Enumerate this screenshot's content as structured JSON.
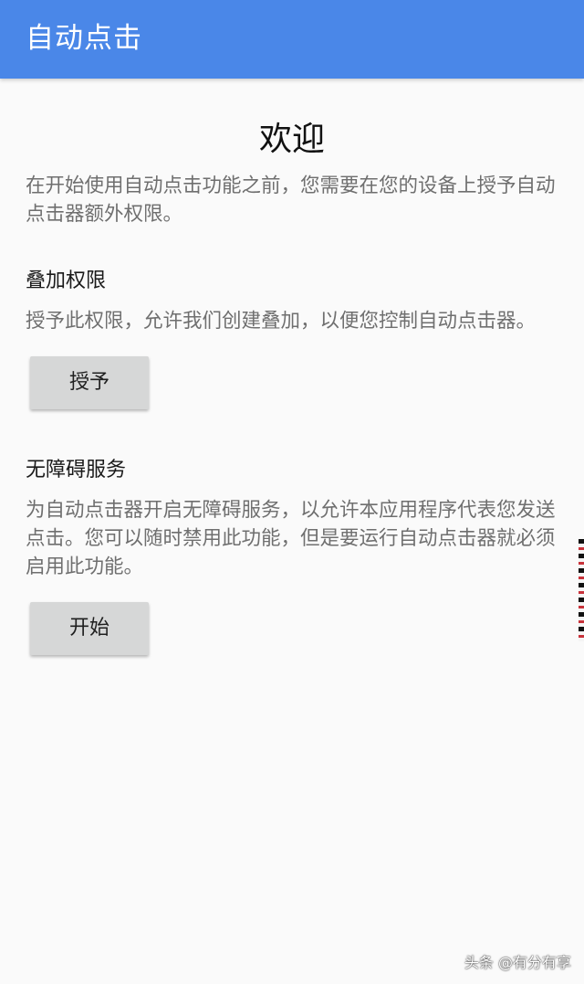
{
  "app_bar": {
    "title": "自动点击"
  },
  "main": {
    "welcome_title": "欢迎",
    "intro_text": "在开始使用自动点击功能之前，您需要在您的设备上授予自动点击器额外权限。",
    "overlay_section": {
      "title": "叠加权限",
      "description": "授予此权限，允许我们创建叠加，以便您控制自动点击器。",
      "button_label": "授予"
    },
    "accessibility_section": {
      "title": "无障碍服务",
      "description": "为自动点击器开启无障碍服务，以允许本应用程序代表您发送点击。您可以随时禁用此功能，但是要运行自动点击器就必须启用此功能。",
      "button_label": "开始"
    }
  },
  "watermark": "头条 @有分有享",
  "colors": {
    "app_bar": "#4A87E8",
    "background": "#FAFAFA",
    "button": "#D6D7D7"
  }
}
